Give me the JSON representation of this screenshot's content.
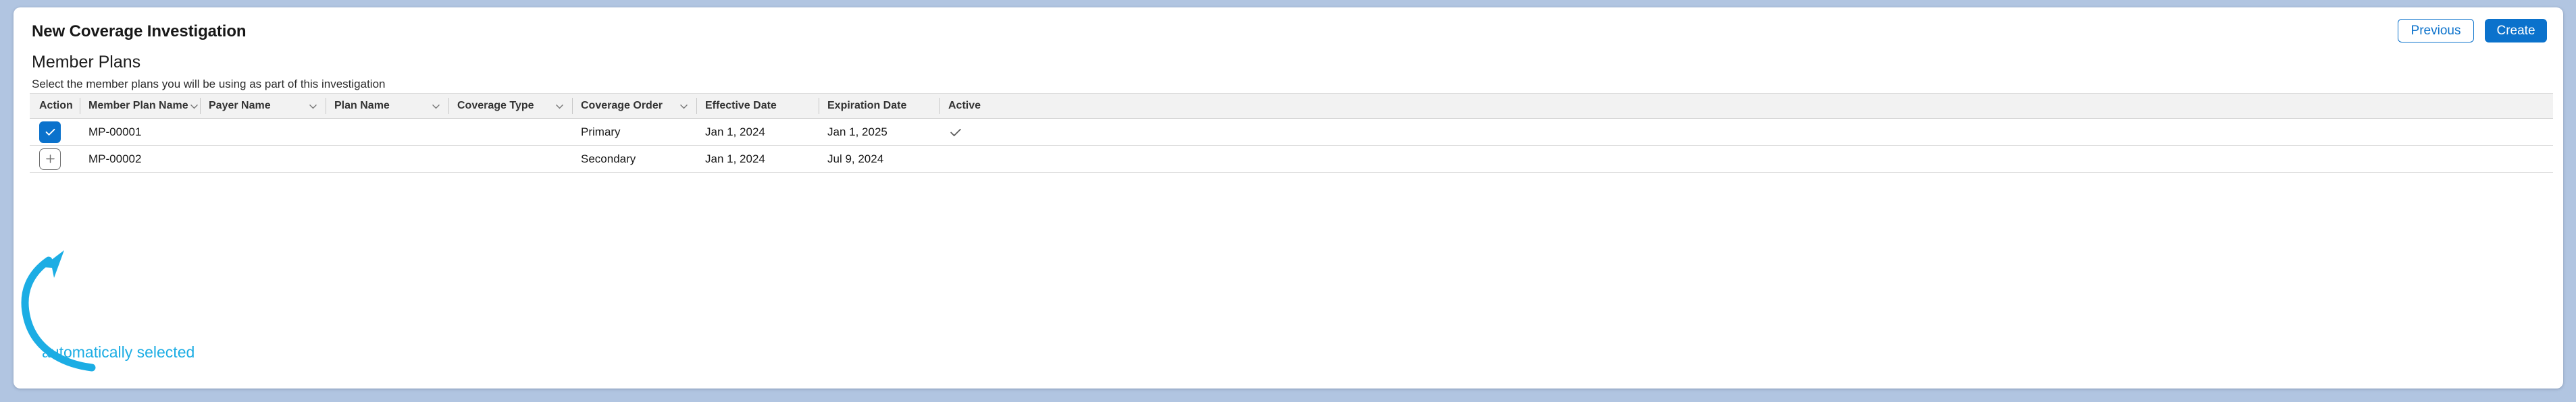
{
  "page": {
    "title": "New Coverage Investigation",
    "background_color": "#b1c5e1",
    "accent_color": "#0b72cc"
  },
  "toolbar": {
    "previous_label": "Previous",
    "create_label": "Create"
  },
  "section": {
    "heading": "Member Plans",
    "subheading": "Select the member plans you will be using as part of this investigation"
  },
  "table": {
    "columns": [
      {
        "label": "Action",
        "sortable": false
      },
      {
        "label": "Member Plan Name",
        "sortable": true
      },
      {
        "label": "Payer Name",
        "sortable": true
      },
      {
        "label": "Plan Name",
        "sortable": true
      },
      {
        "label": "Coverage Type",
        "sortable": true
      },
      {
        "label": "Coverage Order",
        "sortable": true
      },
      {
        "label": "Effective Date",
        "sortable": false
      },
      {
        "label": "Expiration Date",
        "sortable": false
      },
      {
        "label": "Active",
        "sortable": false
      }
    ],
    "rows": [
      {
        "action_state": "selected",
        "action_icon": "check-icon",
        "member_plan_name": "MP-00001",
        "payer_name": "",
        "plan_name": "",
        "coverage_type": "",
        "coverage_order": "Primary",
        "effective_date": "Jan 1, 2024",
        "expiration_date": "Jan 1, 2025",
        "active": true,
        "active_icon": "check-icon"
      },
      {
        "action_state": "unselected",
        "action_icon": "plus-icon",
        "member_plan_name": "MP-00002",
        "payer_name": "",
        "plan_name": "",
        "coverage_type": "",
        "coverage_order": "Secondary",
        "effective_date": "Jan 1, 2024",
        "expiration_date": "Jul 9, 2024",
        "active": false,
        "active_icon": ""
      }
    ]
  },
  "annotation": {
    "text": "automatically selected",
    "color": "#1cade4",
    "arrow_icon": "curved-arrow-icon"
  }
}
